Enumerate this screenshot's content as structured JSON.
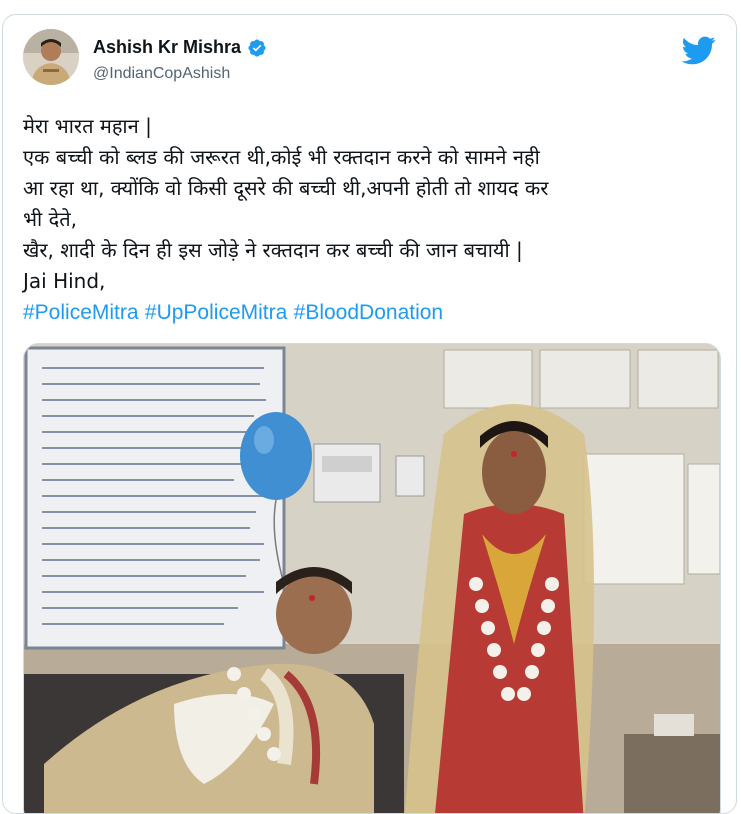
{
  "author": {
    "display_name": "Ashish Kr Mishra",
    "handle": "@IndianCopAshish",
    "verified": true
  },
  "tweet": {
    "lines": [
      "मेरा भारत महान |",
      "एक बच्ची को ब्लड की जरूरत थी,कोई भी रक्तदान करने को सामने नही",
      "आ रहा था, क्योंकि वो किसी दूसरे की बच्ची थी,अपनी होती तो शायद कर",
      "भी देते,",
      "खैर, शादी के दिन ही इस जोड़े ने रक्तदान कर बच्ची की जान बचायी |",
      "Jai Hind,"
    ],
    "hashtags": [
      "#PoliceMitra",
      "#UpPoliceMitra",
      "#BloodDonation"
    ]
  },
  "media": {
    "description_icon": "photo"
  },
  "icons": {
    "verified": "verified-badge-icon",
    "brand": "twitter-bird-icon"
  },
  "colors": {
    "link": "#1d9bf0",
    "text": "#0f1419",
    "secondary": "#536471",
    "border": "#cfd9de"
  }
}
